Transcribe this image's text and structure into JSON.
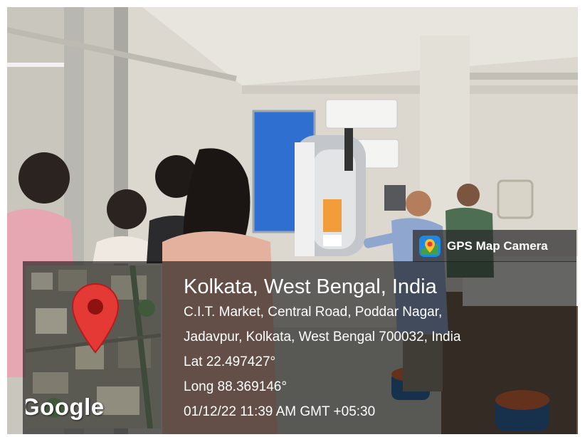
{
  "badge": {
    "label": "GPS Map Camera",
    "icon": "map-pin-camera-icon",
    "accent": "#1e88e5",
    "pin_color": "#fbc02d"
  },
  "map": {
    "brand": "Google",
    "marker_icon": "map-marker-icon",
    "marker_color": "#e53935"
  },
  "location": {
    "title": "Kolkata, West Bengal, India",
    "address_line1": "C.I.T. Market, Central Road, Poddar Nagar,",
    "address_line2": "Jadavpur, Kolkata, West Bengal 700032, India",
    "lat": "Lat 22.497427°",
    "long": "Long 88.369146°",
    "timestamp": "01/12/22 11:39 AM GMT +05:30"
  }
}
